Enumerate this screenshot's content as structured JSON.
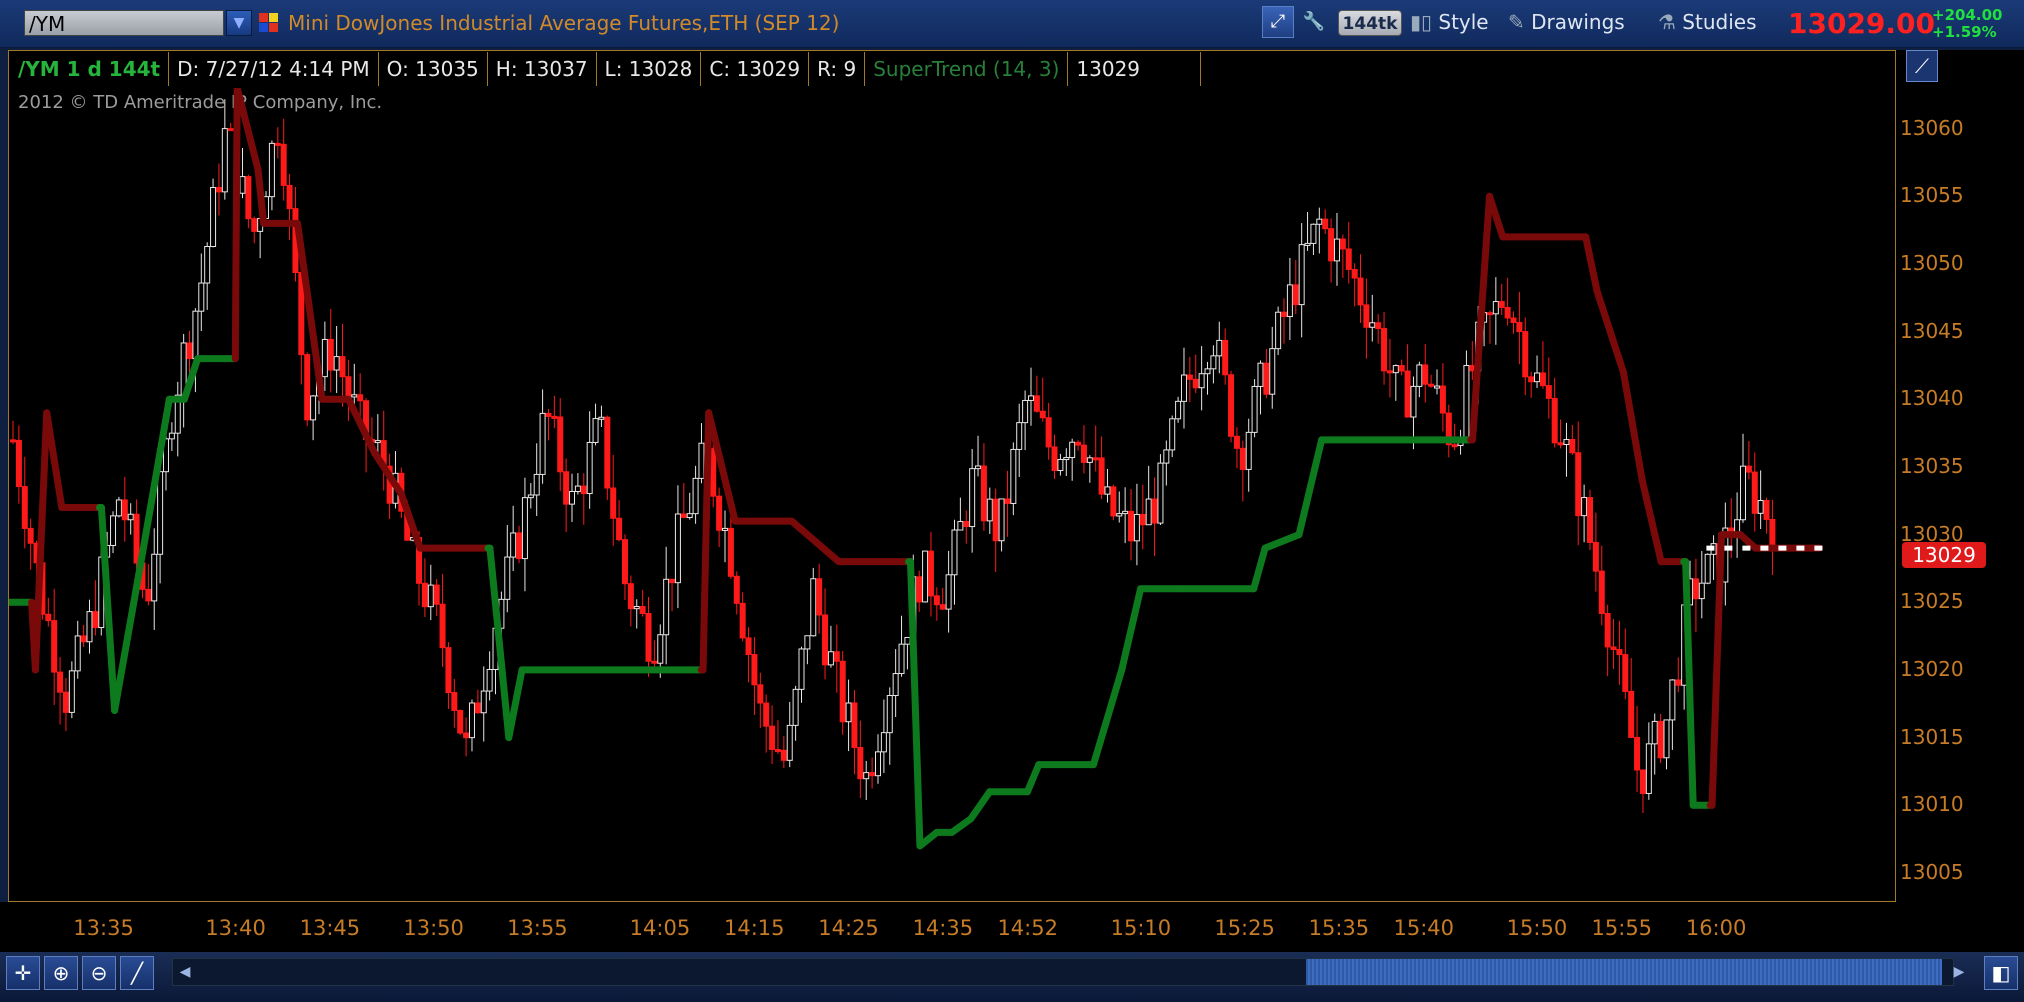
{
  "header": {
    "symbol": "/YM",
    "contract_name": "Mini DowJones Industrial Average Futures,ETH (SEP 12)",
    "tick_badge": "144tk",
    "style_label": "Style",
    "drawings_label": "Drawings",
    "studies_label": "Studies",
    "last_price": "13029.00",
    "net_change": "+204.00",
    "pct_change": "+1.59%"
  },
  "info_bar": {
    "symbol_agg": "/YM 1 d 144t",
    "date": "D: 7/27/12 4:14 PM",
    "open": "O: 13035",
    "high": "H: 13037",
    "low": "L: 13028",
    "close": "C: 13029",
    "range": "R: 9",
    "study": "SuperTrend (14, 3)",
    "study_value": "13029"
  },
  "copyright": "2012 © TD Ameritrade IP Company, Inc.",
  "price_tag": "13029",
  "colors": {
    "up": "#e8e8e8",
    "down": "#ff1a1a",
    "st_up": "#0e7a1e",
    "st_down": "#7a0a0a",
    "axis": "#c77c27"
  },
  "chart_data": {
    "type": "candlestick",
    "ylim": [
      13003,
      13063
    ],
    "yticks": [
      13005,
      13010,
      13015,
      13020,
      13025,
      13030,
      13035,
      13040,
      13045,
      13050,
      13055,
      13060
    ],
    "time_ticks": [
      "13:35",
      "13:40",
      "13:45",
      "13:50",
      "13:55",
      "14:05",
      "14:15",
      "14:25",
      "14:35",
      "14:52",
      "15:10",
      "15:25",
      "15:35",
      "15:40",
      "15:50",
      "15:55",
      "16:00"
    ],
    "close_path": [
      13037,
      13026,
      13018,
      13024,
      13033,
      13025,
      13040,
      13048,
      13060,
      13052,
      13061,
      13040,
      13044,
      13038,
      13035,
      13028,
      13023,
      13014,
      13023,
      13030,
      13039,
      13032,
      13038,
      13026,
      13022,
      13030,
      13036,
      13028,
      13017,
      13013,
      13026,
      13018,
      13012,
      13020,
      13027,
      13026,
      13034,
      13030,
      13040,
      13036,
      13038,
      13032,
      13030,
      13033,
      13041,
      13045,
      13036,
      13042,
      13048,
      13053,
      13050,
      13046,
      13040,
      13042,
      13037,
      13044,
      13048,
      13042,
      13038,
      13031,
      13022,
      13012,
      13016,
      13026,
      13028,
      13034,
      13031
    ],
    "supertrend": [
      {
        "x": 0.0,
        "y": 13025,
        "c": "up"
      },
      {
        "x": 0.012,
        "y": 13025,
        "c": "up"
      },
      {
        "x": 0.014,
        "y": 13020,
        "c": "down"
      },
      {
        "x": 0.02,
        "y": 13039,
        "c": "down"
      },
      {
        "x": 0.028,
        "y": 13032,
        "c": "down"
      },
      {
        "x": 0.048,
        "y": 13032,
        "c": "down"
      },
      {
        "x": 0.049,
        "y": 13032,
        "c": "up"
      },
      {
        "x": 0.056,
        "y": 13017,
        "c": "up"
      },
      {
        "x": 0.07,
        "y": 13028,
        "c": "up"
      },
      {
        "x": 0.085,
        "y": 13040,
        "c": "up"
      },
      {
        "x": 0.093,
        "y": 13040,
        "c": "up"
      },
      {
        "x": 0.1,
        "y": 13043,
        "c": "up"
      },
      {
        "x": 0.12,
        "y": 13043,
        "c": "up"
      },
      {
        "x": 0.121,
        "y": 13063,
        "c": "down"
      },
      {
        "x": 0.132,
        "y": 13057,
        "c": "down"
      },
      {
        "x": 0.135,
        "y": 13053,
        "c": "down"
      },
      {
        "x": 0.153,
        "y": 13053,
        "c": "down"
      },
      {
        "x": 0.166,
        "y": 13040,
        "c": "down"
      },
      {
        "x": 0.18,
        "y": 13040,
        "c": "down"
      },
      {
        "x": 0.194,
        "y": 13036,
        "c": "down"
      },
      {
        "x": 0.208,
        "y": 13033,
        "c": "down"
      },
      {
        "x": 0.218,
        "y": 13029,
        "c": "down"
      },
      {
        "x": 0.254,
        "y": 13029,
        "c": "down"
      },
      {
        "x": 0.255,
        "y": 13029,
        "c": "up"
      },
      {
        "x": 0.265,
        "y": 13015,
        "c": "up"
      },
      {
        "x": 0.272,
        "y": 13020,
        "c": "up"
      },
      {
        "x": 0.367,
        "y": 13020,
        "c": "up"
      },
      {
        "x": 0.368,
        "y": 13020,
        "c": "down"
      },
      {
        "x": 0.371,
        "y": 13039,
        "c": "down"
      },
      {
        "x": 0.385,
        "y": 13031,
        "c": "down"
      },
      {
        "x": 0.415,
        "y": 13031,
        "c": "down"
      },
      {
        "x": 0.44,
        "y": 13028,
        "c": "down"
      },
      {
        "x": 0.477,
        "y": 13028,
        "c": "down"
      },
      {
        "x": 0.478,
        "y": 13028,
        "c": "up"
      },
      {
        "x": 0.483,
        "y": 13007,
        "c": "up"
      },
      {
        "x": 0.492,
        "y": 13008,
        "c": "up"
      },
      {
        "x": 0.5,
        "y": 13008,
        "c": "up"
      },
      {
        "x": 0.51,
        "y": 13009,
        "c": "up"
      },
      {
        "x": 0.52,
        "y": 13011,
        "c": "up"
      },
      {
        "x": 0.54,
        "y": 13011,
        "c": "up"
      },
      {
        "x": 0.546,
        "y": 13013,
        "c": "up"
      },
      {
        "x": 0.575,
        "y": 13013,
        "c": "up"
      },
      {
        "x": 0.59,
        "y": 13020,
        "c": "up"
      },
      {
        "x": 0.6,
        "y": 13026,
        "c": "up"
      },
      {
        "x": 0.62,
        "y": 13026,
        "c": "up"
      },
      {
        "x": 0.66,
        "y": 13026,
        "c": "up"
      },
      {
        "x": 0.666,
        "y": 13029,
        "c": "up"
      },
      {
        "x": 0.684,
        "y": 13030,
        "c": "up"
      },
      {
        "x": 0.696,
        "y": 13037,
        "c": "up"
      },
      {
        "x": 0.775,
        "y": 13037,
        "c": "up"
      },
      {
        "x": 0.776,
        "y": 13037,
        "c": "down"
      },
      {
        "x": 0.785,
        "y": 13055,
        "c": "down"
      },
      {
        "x": 0.792,
        "y": 13052,
        "c": "down"
      },
      {
        "x": 0.836,
        "y": 13052,
        "c": "down"
      },
      {
        "x": 0.842,
        "y": 13048,
        "c": "down"
      },
      {
        "x": 0.856,
        "y": 13042,
        "c": "down"
      },
      {
        "x": 0.866,
        "y": 13034,
        "c": "down"
      },
      {
        "x": 0.876,
        "y": 13028,
        "c": "down"
      },
      {
        "x": 0.888,
        "y": 13028,
        "c": "down"
      },
      {
        "x": 0.889,
        "y": 13028,
        "c": "up"
      },
      {
        "x": 0.893,
        "y": 13010,
        "c": "up"
      },
      {
        "x": 0.902,
        "y": 13010,
        "c": "up"
      },
      {
        "x": 0.903,
        "y": 13010,
        "c": "down"
      },
      {
        "x": 0.908,
        "y": 13030,
        "c": "down"
      },
      {
        "x": 0.918,
        "y": 13030,
        "c": "down"
      },
      {
        "x": 0.926,
        "y": 13029,
        "c": "down"
      },
      {
        "x": 0.96,
        "y": 13029,
        "c": "down"
      }
    ]
  }
}
